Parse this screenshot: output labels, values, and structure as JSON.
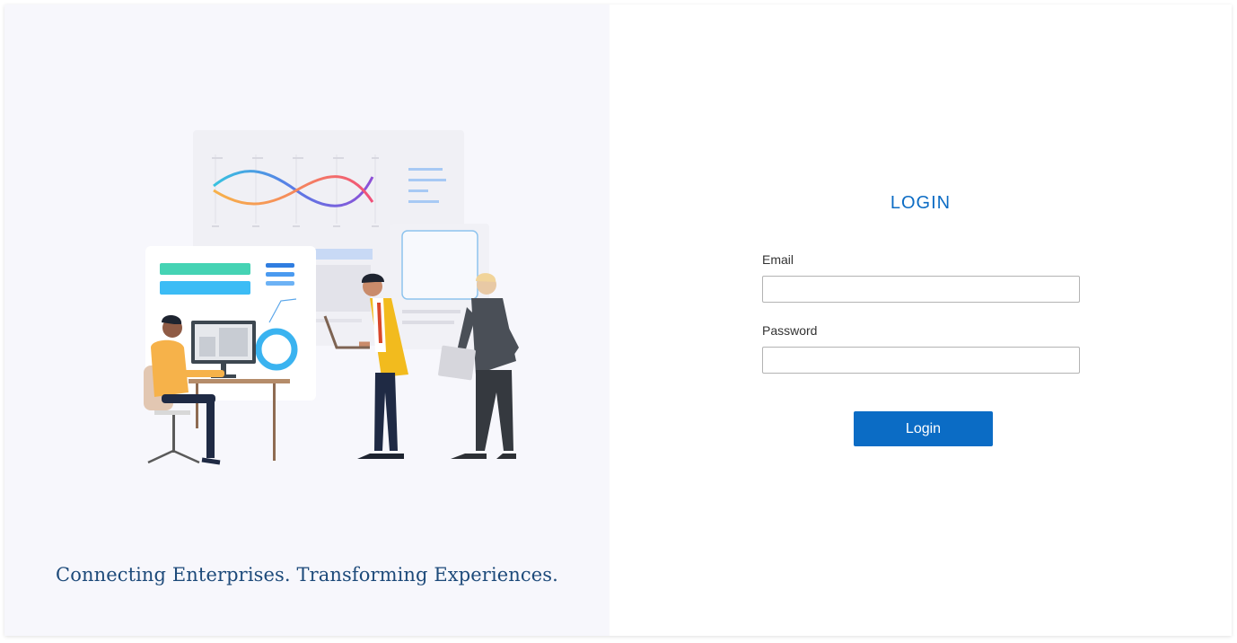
{
  "branding": {
    "tagline": "Connecting Enterprises. Transforming Experiences."
  },
  "login": {
    "title": "LOGIN",
    "email_label": "Email",
    "email_value": "",
    "password_label": "Password",
    "password_value": "",
    "submit_label": "Login"
  },
  "colors": {
    "accent": "#0b6cc5",
    "tagline": "#1d4a7a",
    "left_panel_bg": "#f7f7fc"
  }
}
